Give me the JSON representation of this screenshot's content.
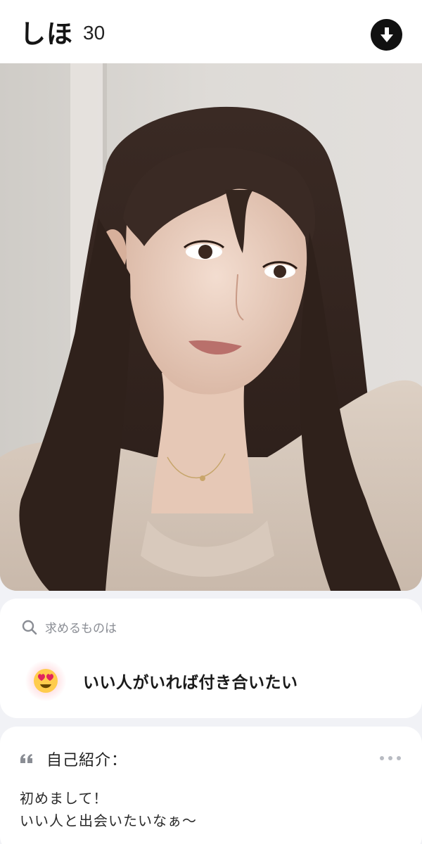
{
  "profile": {
    "name": "しほ",
    "age": "30"
  },
  "header": {
    "download_icon": "arrow-down-circle-icon"
  },
  "photo": {
    "description_icon": "profile-photo"
  },
  "looking_for": {
    "label": "求めるものは",
    "label_icon": "search-icon",
    "value": "いい人がいれば付き合いたい",
    "emoji_icon": "heart-eyes-emoji-icon"
  },
  "intro": {
    "title": "自己紹介：",
    "title_icon": "quote-icon",
    "more_icon": "more-dots-icon",
    "lines": [
      "初めまして！",
      "いい人と出会いたいなぁ〜"
    ]
  },
  "colors": {
    "background": "#f1f2f6",
    "card": "#ffffff",
    "muted_text": "#8a8d94",
    "download_bg": "#111111"
  }
}
